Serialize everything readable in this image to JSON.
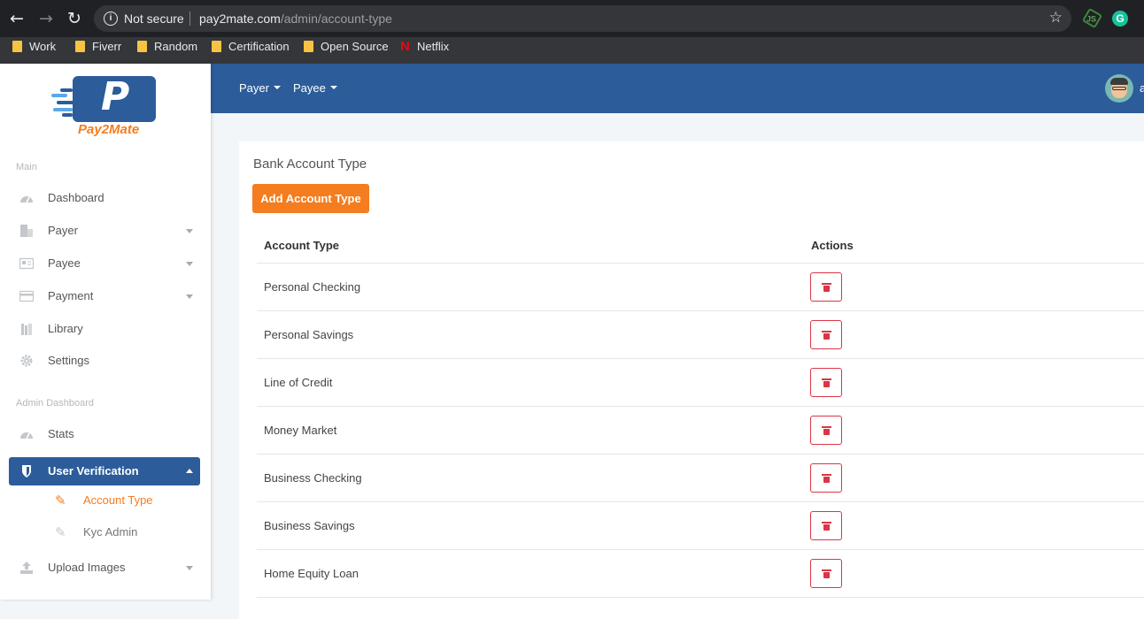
{
  "browser": {
    "security_label": "Not secure",
    "url_host": "pay2mate.com",
    "url_path": "/admin/account-type",
    "bookmarks": [
      {
        "label": "Work",
        "icon": "folder-icon"
      },
      {
        "label": "Fiverr",
        "icon": "folder-icon"
      },
      {
        "label": "Random",
        "icon": "folder-icon"
      },
      {
        "label": "Certification",
        "icon": "folder-icon"
      },
      {
        "label": "Open Source",
        "icon": "folder-icon"
      },
      {
        "label": "Netflix",
        "icon": "netflix-icon"
      }
    ]
  },
  "brand": {
    "logo_letter": "P",
    "name": "Pay2Mate",
    "primary_color": "#2c5c9a",
    "accent_color": "#f57c1f"
  },
  "sidebar": {
    "section_main": "Main",
    "main_items": [
      {
        "label": "Dashboard",
        "icon": "dashboard-icon",
        "has_caret": false
      },
      {
        "label": "Payer",
        "icon": "payer-icon",
        "has_caret": true
      },
      {
        "label": "Payee",
        "icon": "id-card-icon",
        "has_caret": true
      },
      {
        "label": "Payment",
        "icon": "credit-card-icon",
        "has_caret": true
      },
      {
        "label": "Library",
        "icon": "library-icon",
        "has_caret": false
      },
      {
        "label": "Settings",
        "icon": "gear-icon",
        "has_caret": false
      }
    ],
    "section_admin": "Admin Dashboard",
    "stats_label": "Stats",
    "user_verification_label": "User Verification",
    "sub_items": [
      {
        "label": "Account Type",
        "active": true
      },
      {
        "label": "Kyc Admin",
        "active": false
      }
    ],
    "upload_images_label": "Upload Images"
  },
  "topbar": {
    "menus": [
      "Payer",
      "Payee"
    ],
    "user_initial": "a"
  },
  "main": {
    "card_title": "Bank Account Type",
    "add_button_label": "Add Account Type",
    "table": {
      "headers": [
        "Account Type",
        "Actions"
      ],
      "rows": [
        "Personal Checking",
        "Personal Savings",
        "Line of Credit",
        "Money Market",
        "Business Checking",
        "Business Savings",
        "Home Equity Loan"
      ]
    },
    "delete_color": "#dc3545"
  }
}
